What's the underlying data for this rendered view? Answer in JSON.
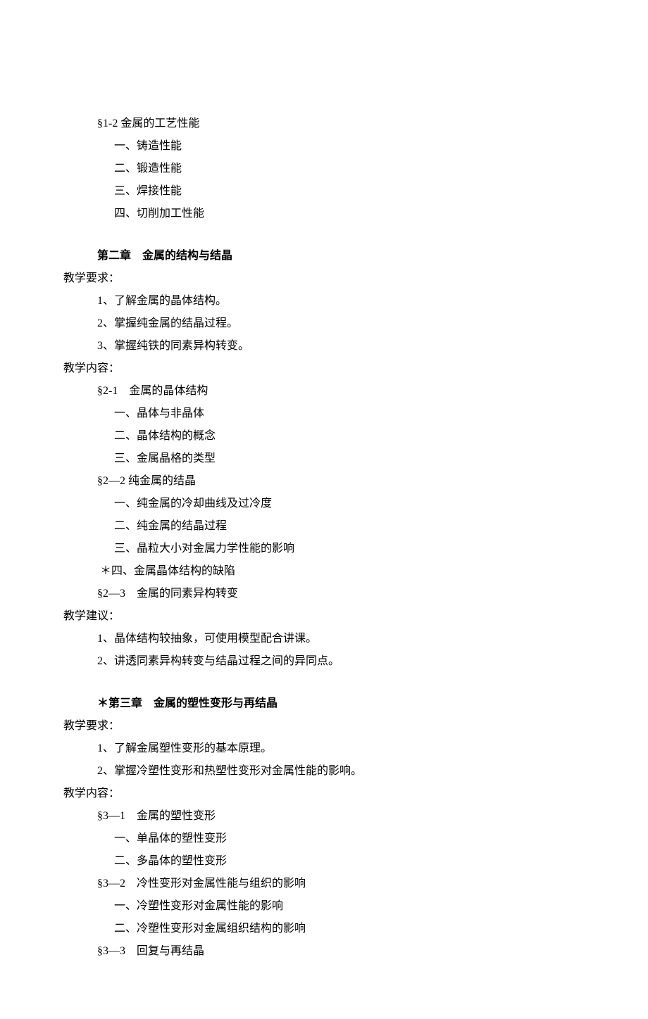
{
  "section1": {
    "heading": "§1-2 金属的工艺性能",
    "items": [
      "一、铸造性能",
      "二、锻造性能",
      "三、焊接性能",
      "四、切削加工性能"
    ]
  },
  "chapter2": {
    "title": "第二章　金属的结构与结晶",
    "req_label": "教学要求：",
    "reqs": [
      "1、了解金属的晶体结构。",
      "2、掌握纯金属的结晶过程。",
      "3、掌握纯铁的同素异构转变。"
    ],
    "content_label": "教学内容：",
    "sub1": {
      "heading": "§2-1　金属的晶体结构",
      "items": [
        "一、晶体与非晶体",
        "二、晶体结构的概念",
        "三、金属晶格的类型"
      ]
    },
    "sub2": {
      "heading": "§2—2 纯金属的结晶",
      "items": [
        "一、纯金属的冷却曲线及过冷度",
        "二、纯金属的结晶过程",
        "三、晶粒大小对金属力学性能的影响",
        " ＊四、金属晶体结构的缺陷"
      ]
    },
    "sub3": {
      "heading": "§2—3　金属的同素异构转变"
    },
    "sugg_label": "教学建议：",
    "suggs": [
      "1、晶体结构较抽象，可使用模型配合讲课。",
      "2、讲透同素异构转变与结晶过程之间的异同点。"
    ]
  },
  "chapter3": {
    "title": "＊第三章　金属的塑性变形与再结晶",
    "req_label": "教学要求：",
    "reqs": [
      "1、了解金属塑性变形的基本原理。",
      "2、掌握冷塑性变形和热塑性变形对金属性能的影响。"
    ],
    "content_label": "教学内容：",
    "sub1": {
      "heading": "§3—1　金属的塑性变形",
      "items": [
        "一、单晶体的塑性变形",
        "二、多晶体的塑性变形"
      ]
    },
    "sub2": {
      "heading": "§3—2　冷性变形对金属性能与组织的影响",
      "items": [
        "一、冷塑性变形对金属性能的影响",
        "二、冷塑性变形对金属组织结构的影响"
      ]
    },
    "sub3": {
      "heading": "§3—3　回复与再结晶"
    }
  }
}
